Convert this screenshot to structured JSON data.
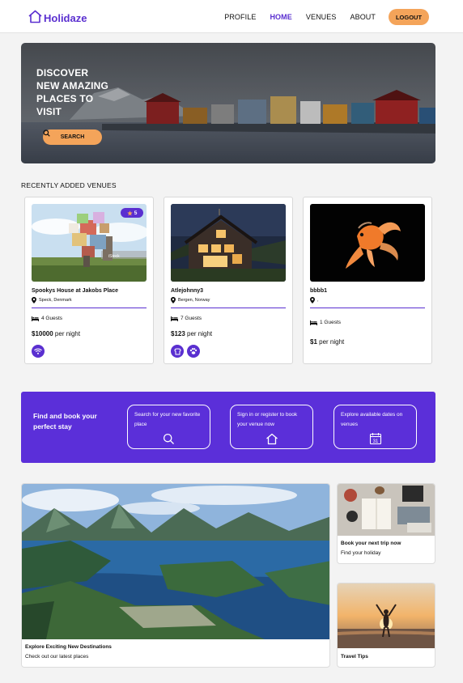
{
  "app": {
    "name": "Holidaze",
    "logo_icon": "house-icon"
  },
  "nav": {
    "links": [
      "PROFILE",
      "HOME",
      "VENUES",
      "ABOUT"
    ],
    "active": "HOME",
    "logout_label": "LOGOUT"
  },
  "hero": {
    "title_lines": [
      "DISCOVER",
      "NEW AMAZING",
      "PLACES TO",
      "VISIT"
    ],
    "search_label": "SEARCH",
    "search_icon": "search-icon"
  },
  "recent": {
    "heading": "RECENTLY ADDED VENUES",
    "venues": [
      {
        "name": "Spookys House at Jakobs Place",
        "location": "Speck, Denmark",
        "guests": "4 Guests",
        "price": "$10000",
        "price_suffix": " per night",
        "rating": "5",
        "amenities": [
          "wifi-icon"
        ]
      },
      {
        "name": "Atlejohnny3",
        "location": "Bergen, Norway",
        "guests": "7 Guests",
        "price": "$123",
        "price_suffix": " per night",
        "rating": "",
        "amenities": [
          "breakfast-icon",
          "pets-icon"
        ]
      },
      {
        "name": "bbbb1",
        "location": ",",
        "guests": "1 Guests",
        "price": "$1",
        "price_suffix": " per night",
        "rating": "",
        "amenities": []
      }
    ]
  },
  "promo": {
    "title": "Find and book your perfect stay",
    "boxes": [
      {
        "text": "Search for your new favorite place",
        "icon": "search-icon"
      },
      {
        "text": "Sign in or register to book your venue now",
        "icon": "house-icon"
      },
      {
        "text": "Explore available dates on venues",
        "icon": "calendar-icon",
        "icon_text": "31"
      }
    ]
  },
  "features": {
    "main": {
      "title": "Explore Exciting New Destinations",
      "subtitle": "Check out our latest places"
    },
    "side_top": {
      "title": "Book your next trip now",
      "subtitle": "Find your holiday"
    },
    "side_bottom": {
      "title": "Travel Tips"
    }
  },
  "colors": {
    "accent": "#5a2fd0",
    "promo_bg": "#5b2fd9",
    "button": "#f4a45a",
    "page_bg": "#f3f3f3"
  }
}
